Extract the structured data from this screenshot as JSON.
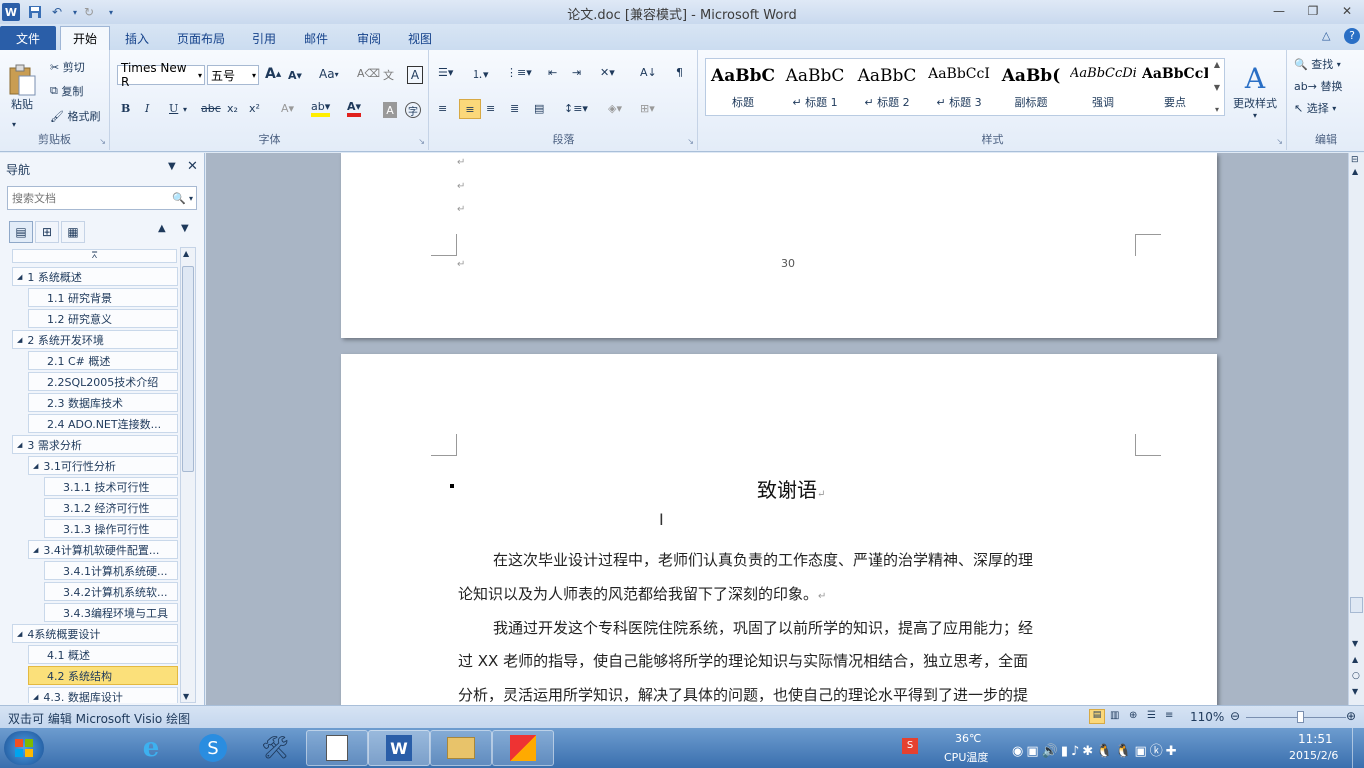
{
  "window": {
    "title": "论文.doc [兼容模式] - Microsoft Word"
  },
  "tabs": [
    "文件",
    "开始",
    "插入",
    "页面布局",
    "引用",
    "邮件",
    "审阅",
    "视图"
  ],
  "clipboard": {
    "paste": "粘贴",
    "cut": "剪切",
    "copy": "复制",
    "format_painter": "格式刷",
    "group": "剪贴板"
  },
  "font": {
    "name": "Times New R",
    "size": "五号",
    "group": "字体",
    "change_case": "Aa",
    "grow": "A",
    "shrink": "A"
  },
  "paragraph": {
    "group": "段落"
  },
  "styles": {
    "group": "样式",
    "items": [
      {
        "sample": "AaBbC",
        "name": "标题",
        "style": "bold"
      },
      {
        "sample": "AaBbC",
        "name": "↵ 标题 1",
        "style": "normal"
      },
      {
        "sample": "AaBbC",
        "name": "↵ 标题 2",
        "style": "normal"
      },
      {
        "sample": "AaBbCcI",
        "name": "↵ 标题 3",
        "style": "normal"
      },
      {
        "sample": "AaBb(",
        "name": "副标题",
        "style": "bold"
      },
      {
        "sample": "AaBbCcDi",
        "name": "强调",
        "style": "italic"
      },
      {
        "sample": "AaBbCcD",
        "name": "要点",
        "style": "bold"
      }
    ],
    "change_styles": "更改样式"
  },
  "editing": {
    "find": "查找",
    "replace": "替换",
    "select": "选择",
    "group": "编辑"
  },
  "nav": {
    "title": "导航",
    "search_placeholder": "搜索文档",
    "items": [
      {
        "label": "1 系统概述",
        "level": 1
      },
      {
        "label": "1.1 研究背景",
        "level": 2
      },
      {
        "label": "1.2 研究意义",
        "level": 2
      },
      {
        "label": "2 系统开发环境",
        "level": 1
      },
      {
        "label": "2.1 C# 概述",
        "level": 2
      },
      {
        "label": "2.2SQL2005技术介绍",
        "level": 2
      },
      {
        "label": "2.3 数据库技术",
        "level": 2
      },
      {
        "label": "2.4  ADO.NET连接数...",
        "level": 2
      },
      {
        "label": "3 需求分析",
        "level": 1
      },
      {
        "label": "3.1可行性分析",
        "level": 2,
        "expanded": true
      },
      {
        "label": "3.1.1 技术可行性",
        "level": 3
      },
      {
        "label": "3.1.2 经济可行性",
        "level": 3
      },
      {
        "label": "3.1.3 操作可行性",
        "level": 3
      },
      {
        "label": "3.4计算机软硬件配置...",
        "level": 2,
        "expanded": true
      },
      {
        "label": "3.4.1计算机系统硬...",
        "level": 3
      },
      {
        "label": "3.4.2计算机系统软...",
        "level": 3
      },
      {
        "label": "3.4.3编程环境与工具",
        "level": 3
      },
      {
        "label": "4系统概要设计",
        "level": 1
      },
      {
        "label": "4.1 概述",
        "level": 2
      },
      {
        "label": "4.2 系统结构",
        "level": 2,
        "selected": true
      },
      {
        "label": "4.3. 数据库设计",
        "level": 2,
        "expanded": true
      }
    ]
  },
  "document": {
    "page_number": "30",
    "heading": "致谢语",
    "paragraphs": [
      "在这次毕业设计过程中，老师们认真负责的工作态度、严谨的治学精神、深厚的理",
      "论知识以及为人师表的风范都给我留下了深刻的印象。",
      "我通过开发这个专科医院住院系统，巩固了以前所学的知识，提高了应用能力；经",
      "过 XX 老师的指导，使自己能够将所学的理论知识与实际情况相结合，独立思考，全面",
      "分析，灵活运用所学知识，解决了具体的问题，也使自己的理论水平得到了进一步的提"
    ],
    "paragraph_mark": "↵"
  },
  "status": {
    "text": "双击可 编辑 Microsoft Visio 绘图",
    "zoom": "110%",
    "zoom_level": 0.55
  },
  "taskbar": {
    "temp": "36℃",
    "cpu_label": "CPU温度",
    "time": "11:51",
    "date": "2015/2/6"
  }
}
